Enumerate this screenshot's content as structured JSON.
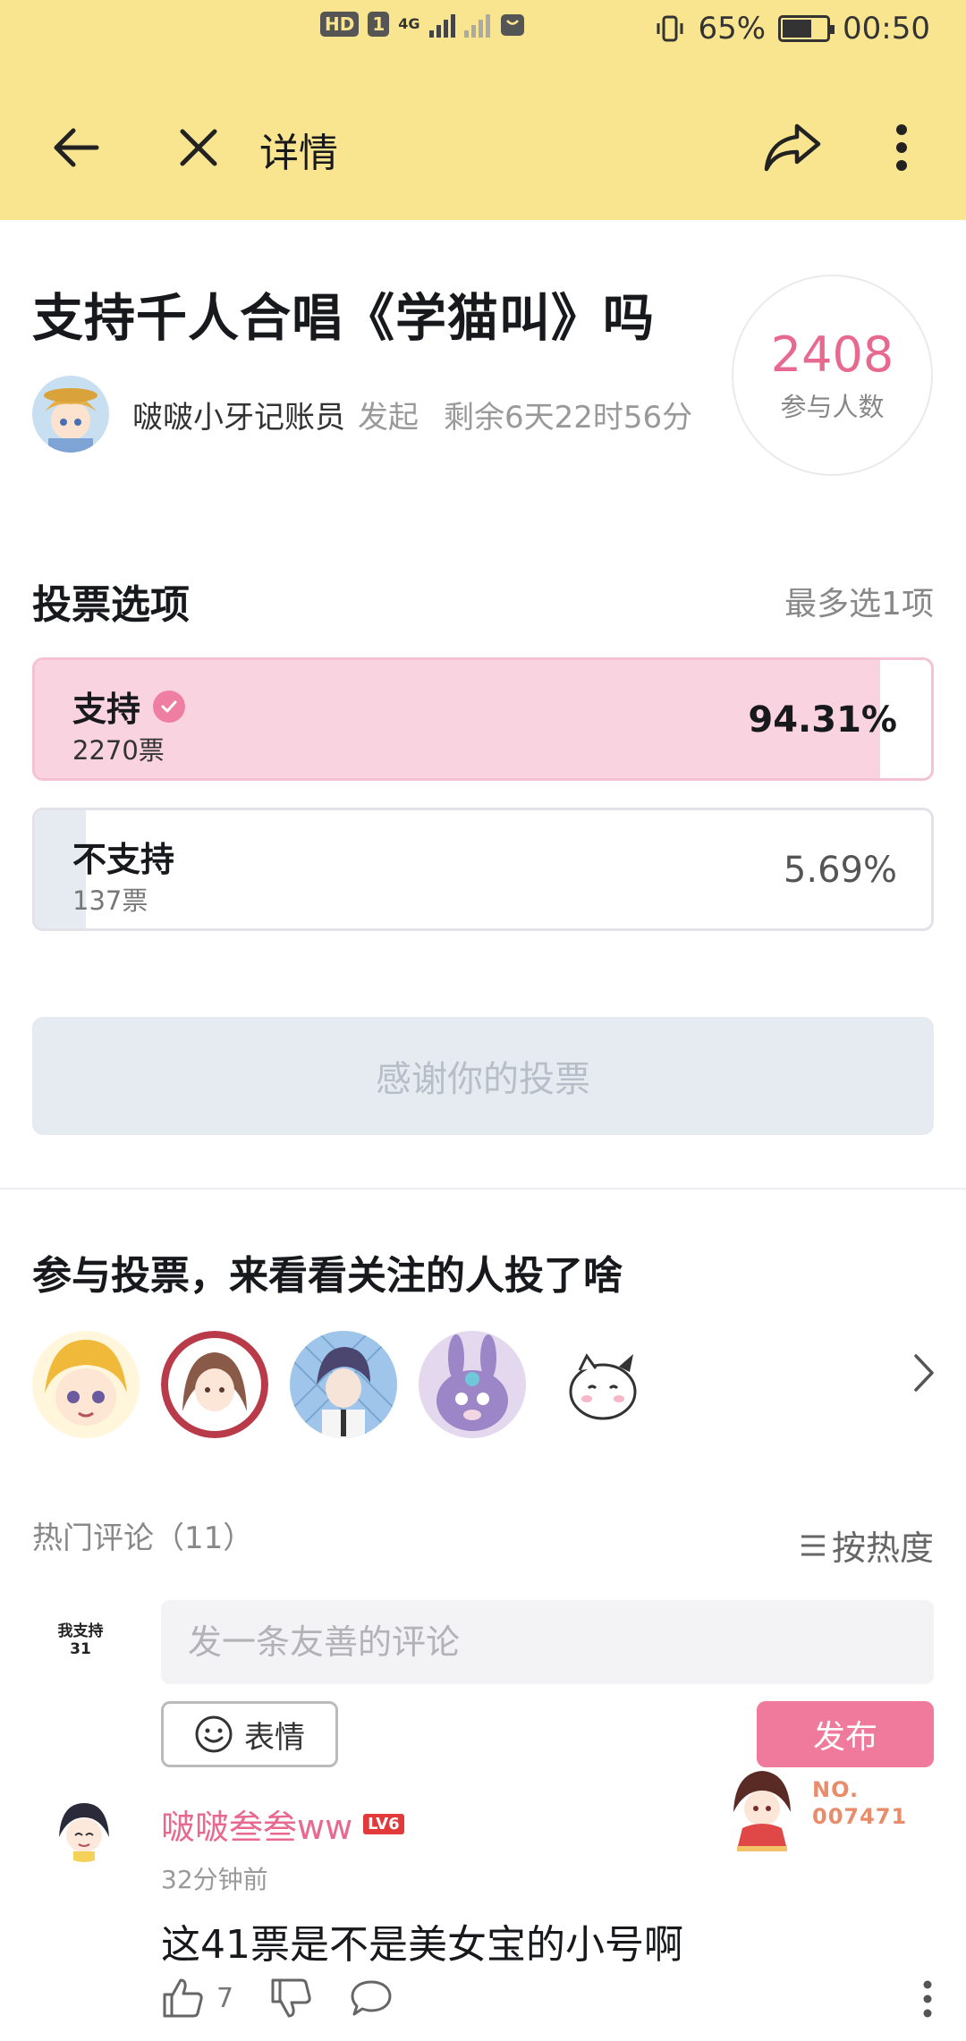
{
  "status_bar": {
    "hd": "HD",
    "sim": "1",
    "network": "4G",
    "battery_percent": "65%",
    "time": "00:50"
  },
  "header": {
    "title": "详情"
  },
  "vote": {
    "title": "支持千人合唱《学猫叫》吗",
    "author": "啵啵小牙记账员",
    "author_action": "发起",
    "remaining": "剩余6天22时56分",
    "participants": "2408",
    "participants_label": "参与人数"
  },
  "options_section": {
    "title": "投票选项",
    "hint": "最多选1项",
    "options": [
      {
        "name": "支持",
        "votes": "2270票",
        "percent": "94.31%",
        "fraction": 0.9431,
        "selected": true
      },
      {
        "name": "不支持",
        "votes": "137票",
        "percent": "5.69%",
        "fraction": 0.0569,
        "selected": false
      }
    ],
    "thanks_button": "感谢你的投票"
  },
  "friends_section": {
    "title": "参与投票，来看看关注的人投了啥",
    "avatars": [
      "avatar-1",
      "avatar-2",
      "avatar-3",
      "avatar-4",
      "avatar-5"
    ]
  },
  "comments": {
    "title": "热门评论（11）",
    "sort_label": "按热度",
    "stance_line1": "我支持",
    "stance_line2": "31",
    "input_placeholder": "发一条友善的评论",
    "emoji_label": "表情",
    "publish_label": "发布",
    "items": [
      {
        "user": "啵啵叁叁ww",
        "level": "LV6",
        "time": "32分钟前",
        "text": "这41票是不是美女宝的小号啊",
        "likes": "7",
        "fan_badge_line1": "NO.",
        "fan_badge_line2": "007471"
      }
    ]
  },
  "colors": {
    "header_bg": "#f9e58f",
    "accent_pink": "#e8698f",
    "selected_bar": "#f9d3df",
    "unselected_bar": "#e6ebf2",
    "publish_bg": "#f07a9c"
  }
}
